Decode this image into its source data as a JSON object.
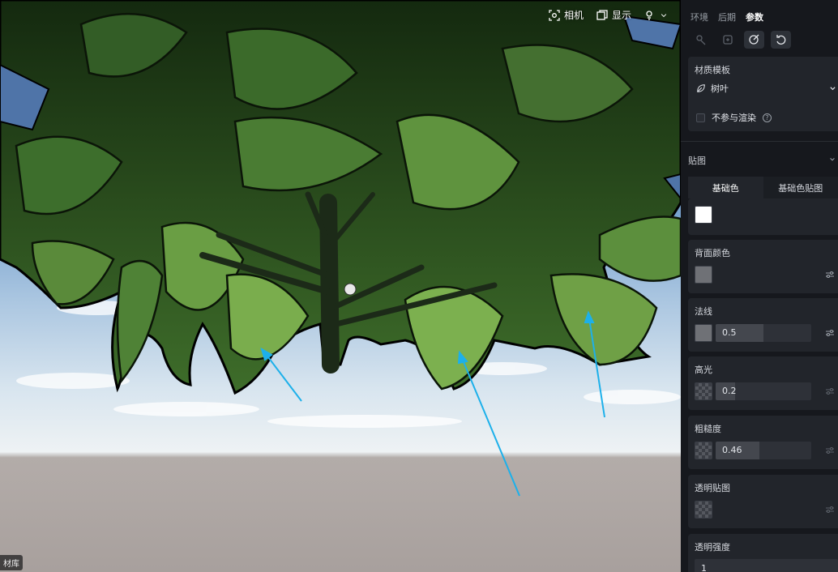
{
  "viewport": {
    "toolbar": [
      {
        "label": "相机",
        "icon": "camera-icon"
      },
      {
        "label": "显示",
        "icon": "display-icon"
      },
      {
        "label": "",
        "icon": "light-icon"
      }
    ],
    "library_tag": "材库"
  },
  "panel": {
    "tabs": [
      {
        "label": "环境",
        "active": false
      },
      {
        "label": "后期",
        "active": false
      },
      {
        "label": "参数",
        "active": true
      }
    ],
    "material_template": {
      "title": "材质模板",
      "value": "树叶",
      "exclude_render_label": "不参与渲染"
    },
    "texture": {
      "title": "贴图",
      "sub_tabs": [
        {
          "label": "基础色",
          "active": true
        },
        {
          "label": "基础色贴图",
          "active": false
        }
      ]
    },
    "properties": {
      "back_color": {
        "label": "背面颜色"
      },
      "normal": {
        "label": "法线",
        "value": "0.5",
        "fraction": 0.5
      },
      "specular": {
        "label": "高光",
        "value": "0.2",
        "fraction": 0.2
      },
      "roughness": {
        "label": "粗糙度",
        "value": "0.46",
        "fraction": 0.46
      },
      "opacity_map": {
        "label": "透明贴图"
      },
      "opacity_strength": {
        "label": "透明强度",
        "value": "1"
      }
    }
  }
}
